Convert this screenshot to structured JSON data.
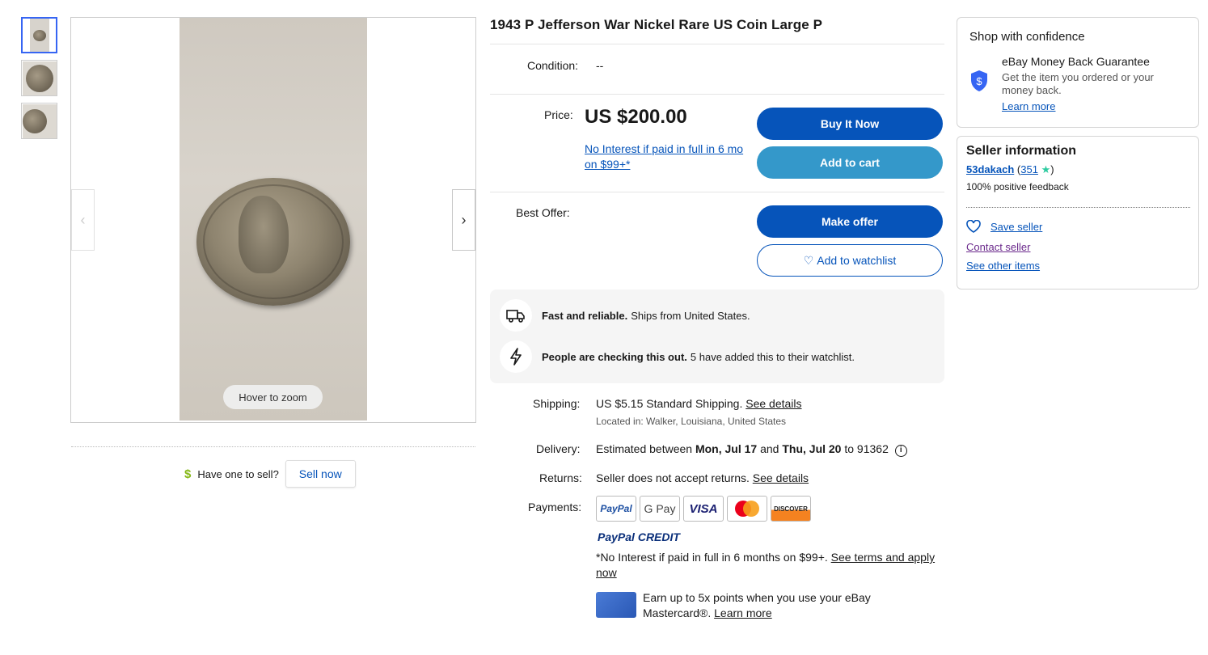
{
  "gallery": {
    "hover_zoom": "Hover to zoom",
    "sell_prompt": "Have one to sell?",
    "sell_button": "Sell now"
  },
  "listing": {
    "title": "1943 P Jefferson War Nickel Rare US Coin Large P",
    "condition_label": "Condition:",
    "condition_value": "--",
    "price_label": "Price:",
    "price_value": "US $200.00",
    "no_interest_link": "No Interest if paid in full in 6 mo on $99+*",
    "buy_it_now": "Buy It Now",
    "add_to_cart": "Add to cart",
    "best_offer_label": "Best Offer:",
    "make_offer": "Make offer",
    "add_to_watchlist": "Add to watchlist"
  },
  "highlights": {
    "row1_bold": "Fast and reliable.",
    "row1_text": "Ships from United States.",
    "row2_bold": "People are checking this out.",
    "row2_text": "5 have added this to their watchlist."
  },
  "details": {
    "shipping_label": "Shipping:",
    "shipping_value": "US $5.15 Standard Shipping.",
    "shipping_link": "See details",
    "located": "Located in: Walker, Louisiana, United States",
    "delivery_label": "Delivery:",
    "delivery_prefix": "Estimated between",
    "delivery_start": "Mon, Jul 17",
    "delivery_and": "and",
    "delivery_end": "Thu, Jul 20",
    "delivery_zip": "to 91362",
    "returns_label": "Returns:",
    "returns_value": "Seller does not accept returns.",
    "returns_link": "See details",
    "payments_label": "Payments:",
    "payment_methods": [
      "PayPal",
      "G Pay",
      "VISA",
      "Mastercard",
      "DISCOVER"
    ],
    "paypal_credit_a": "PayPal",
    "paypal_credit_b": "CREDIT",
    "credit_note": "*No Interest if paid in full in 6 months on $99+.",
    "credit_link": "See terms and apply now",
    "points_text": "Earn up to 5x points when you use your eBay Mastercard®.",
    "points_link": "Learn more"
  },
  "confidence": {
    "title": "Shop with confidence",
    "guarantee_title": "eBay Money Back Guarantee",
    "guarantee_text": "Get the item you ordered or your money back.",
    "learn_more": "Learn more"
  },
  "seller": {
    "title": "Seller information",
    "name": "53dakach",
    "score": "351",
    "feedback": "100% positive feedback",
    "save_seller": "Save seller",
    "contact_seller": "Contact seller",
    "see_other_items": "See other items"
  },
  "colors": {
    "primary_blue": "#0654ba",
    "secondary_blue": "#3498ca",
    "star_teal": "#2dcba0"
  }
}
